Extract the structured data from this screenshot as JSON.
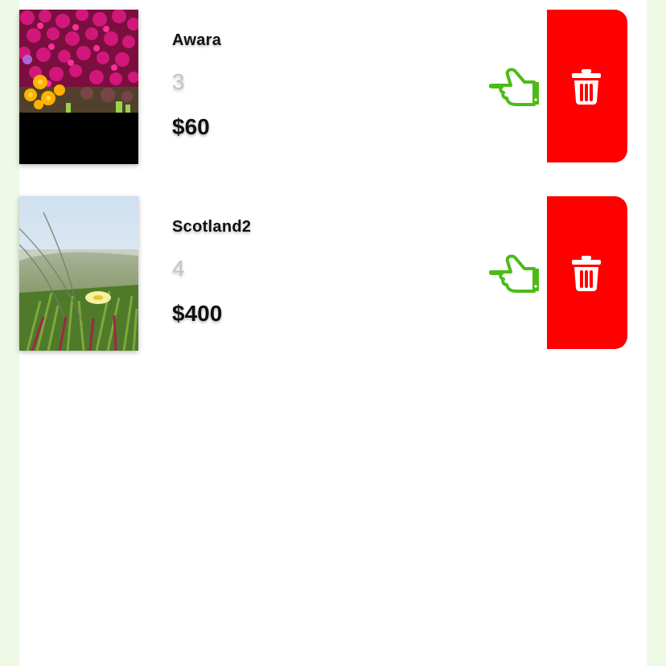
{
  "colors": {
    "page_background": "#eef9e6",
    "panel_background": "#ffffff",
    "delete_button": "#ff0000",
    "hand_icon": "#4cbb17",
    "quantity_text": "#c4c4c4"
  },
  "cart": {
    "items": [
      {
        "name": "Awara",
        "quantity": "3",
        "price": "$60",
        "image": "flowers-photo",
        "action_icon": "pointing-hand-icon",
        "delete_icon": "trash-icon"
      },
      {
        "name": "Scotland2",
        "quantity": "4",
        "price": "$400",
        "image": "beach-dune-photo",
        "action_icon": "pointing-hand-icon",
        "delete_icon": "trash-icon"
      }
    ]
  }
}
